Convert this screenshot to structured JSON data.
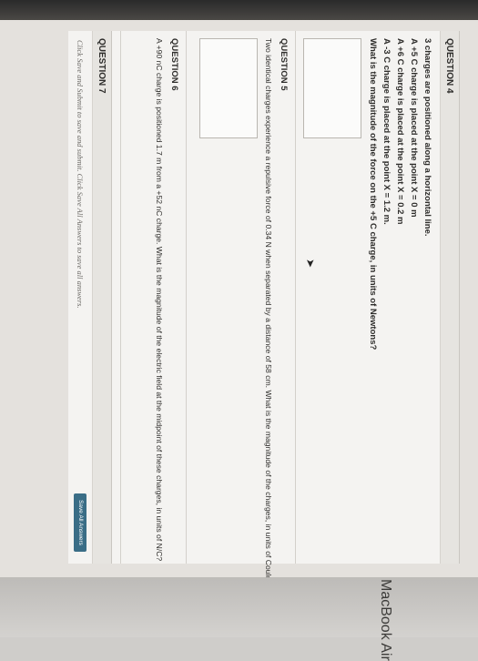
{
  "q4": {
    "title": "QUESTION 4",
    "lines": [
      "3 charges are positioned along a horizontal line.",
      "A +5 C charge is placed at the point X = 0 m",
      "A +6 C charge is placed at the point X = 0.2 m",
      "A -3 C charge is placed at the point X = 1.2 m.",
      "What is the magnitude of the force on the +5 C charge, in units of Newtons?"
    ]
  },
  "q5": {
    "title": "QUESTION 5",
    "text": "Two identical charges experience a repulsive force of 0.34 N when separated by a distance of 58 cm. What is the magnitude of the charges, in units of Coulombs?"
  },
  "q6": {
    "title": "QUESTION 6",
    "text": "A +90 nC charge is positioned 1.7 m from a +52 nC charge. What is the magnitude of the electric field at the midpoint of these charges, in units of N/C?"
  },
  "q7": {
    "title": "QUESTION 7"
  },
  "footer": {
    "note": "Click Save and Submit to save and submit. Click Save All Answers to save all answers.",
    "save_all_label": "Save All Answers"
  },
  "device": {
    "brand": "MacBook Air"
  }
}
